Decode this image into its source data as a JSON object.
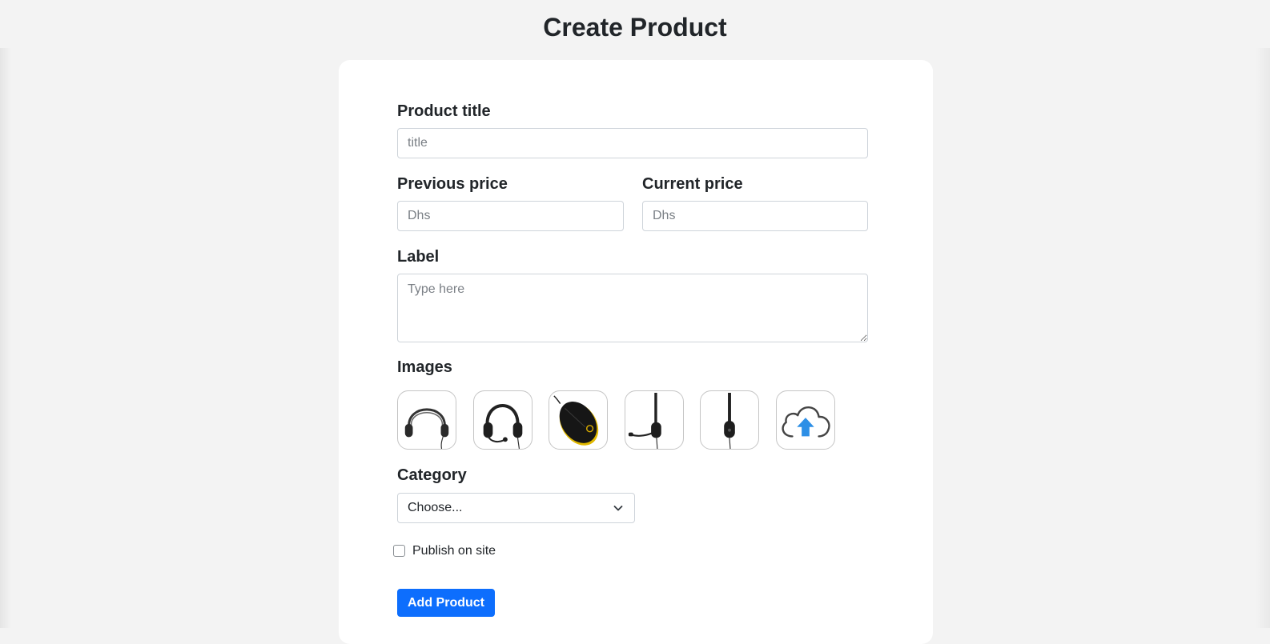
{
  "page": {
    "title": "Create Product"
  },
  "form": {
    "title": {
      "label": "Product title",
      "placeholder": "title",
      "value": ""
    },
    "previous_price": {
      "label": "Previous price",
      "placeholder": "Dhs",
      "value": ""
    },
    "current_price": {
      "label": "Current price",
      "placeholder": "Dhs",
      "value": ""
    },
    "label_field": {
      "label": "Label",
      "placeholder": "Type here",
      "value": ""
    },
    "images": {
      "label": "Images",
      "items": [
        {
          "icon": "headset-icon"
        },
        {
          "icon": "headset-mic-icon"
        },
        {
          "icon": "mouse-icon"
        },
        {
          "icon": "headset-side-icon"
        },
        {
          "icon": "headset-back-icon"
        },
        {
          "icon": "cloud-upload-icon"
        }
      ]
    },
    "category": {
      "label": "Category",
      "selected": "Choose..."
    },
    "publish": {
      "label": "Publish on site",
      "checked": false
    },
    "submit": {
      "label": "Add Product"
    }
  },
  "colors": {
    "primary": "#0d6efd",
    "background": "#f3f3f3",
    "card": "#ffffff",
    "upload_arrow": "#2d8fe6"
  }
}
